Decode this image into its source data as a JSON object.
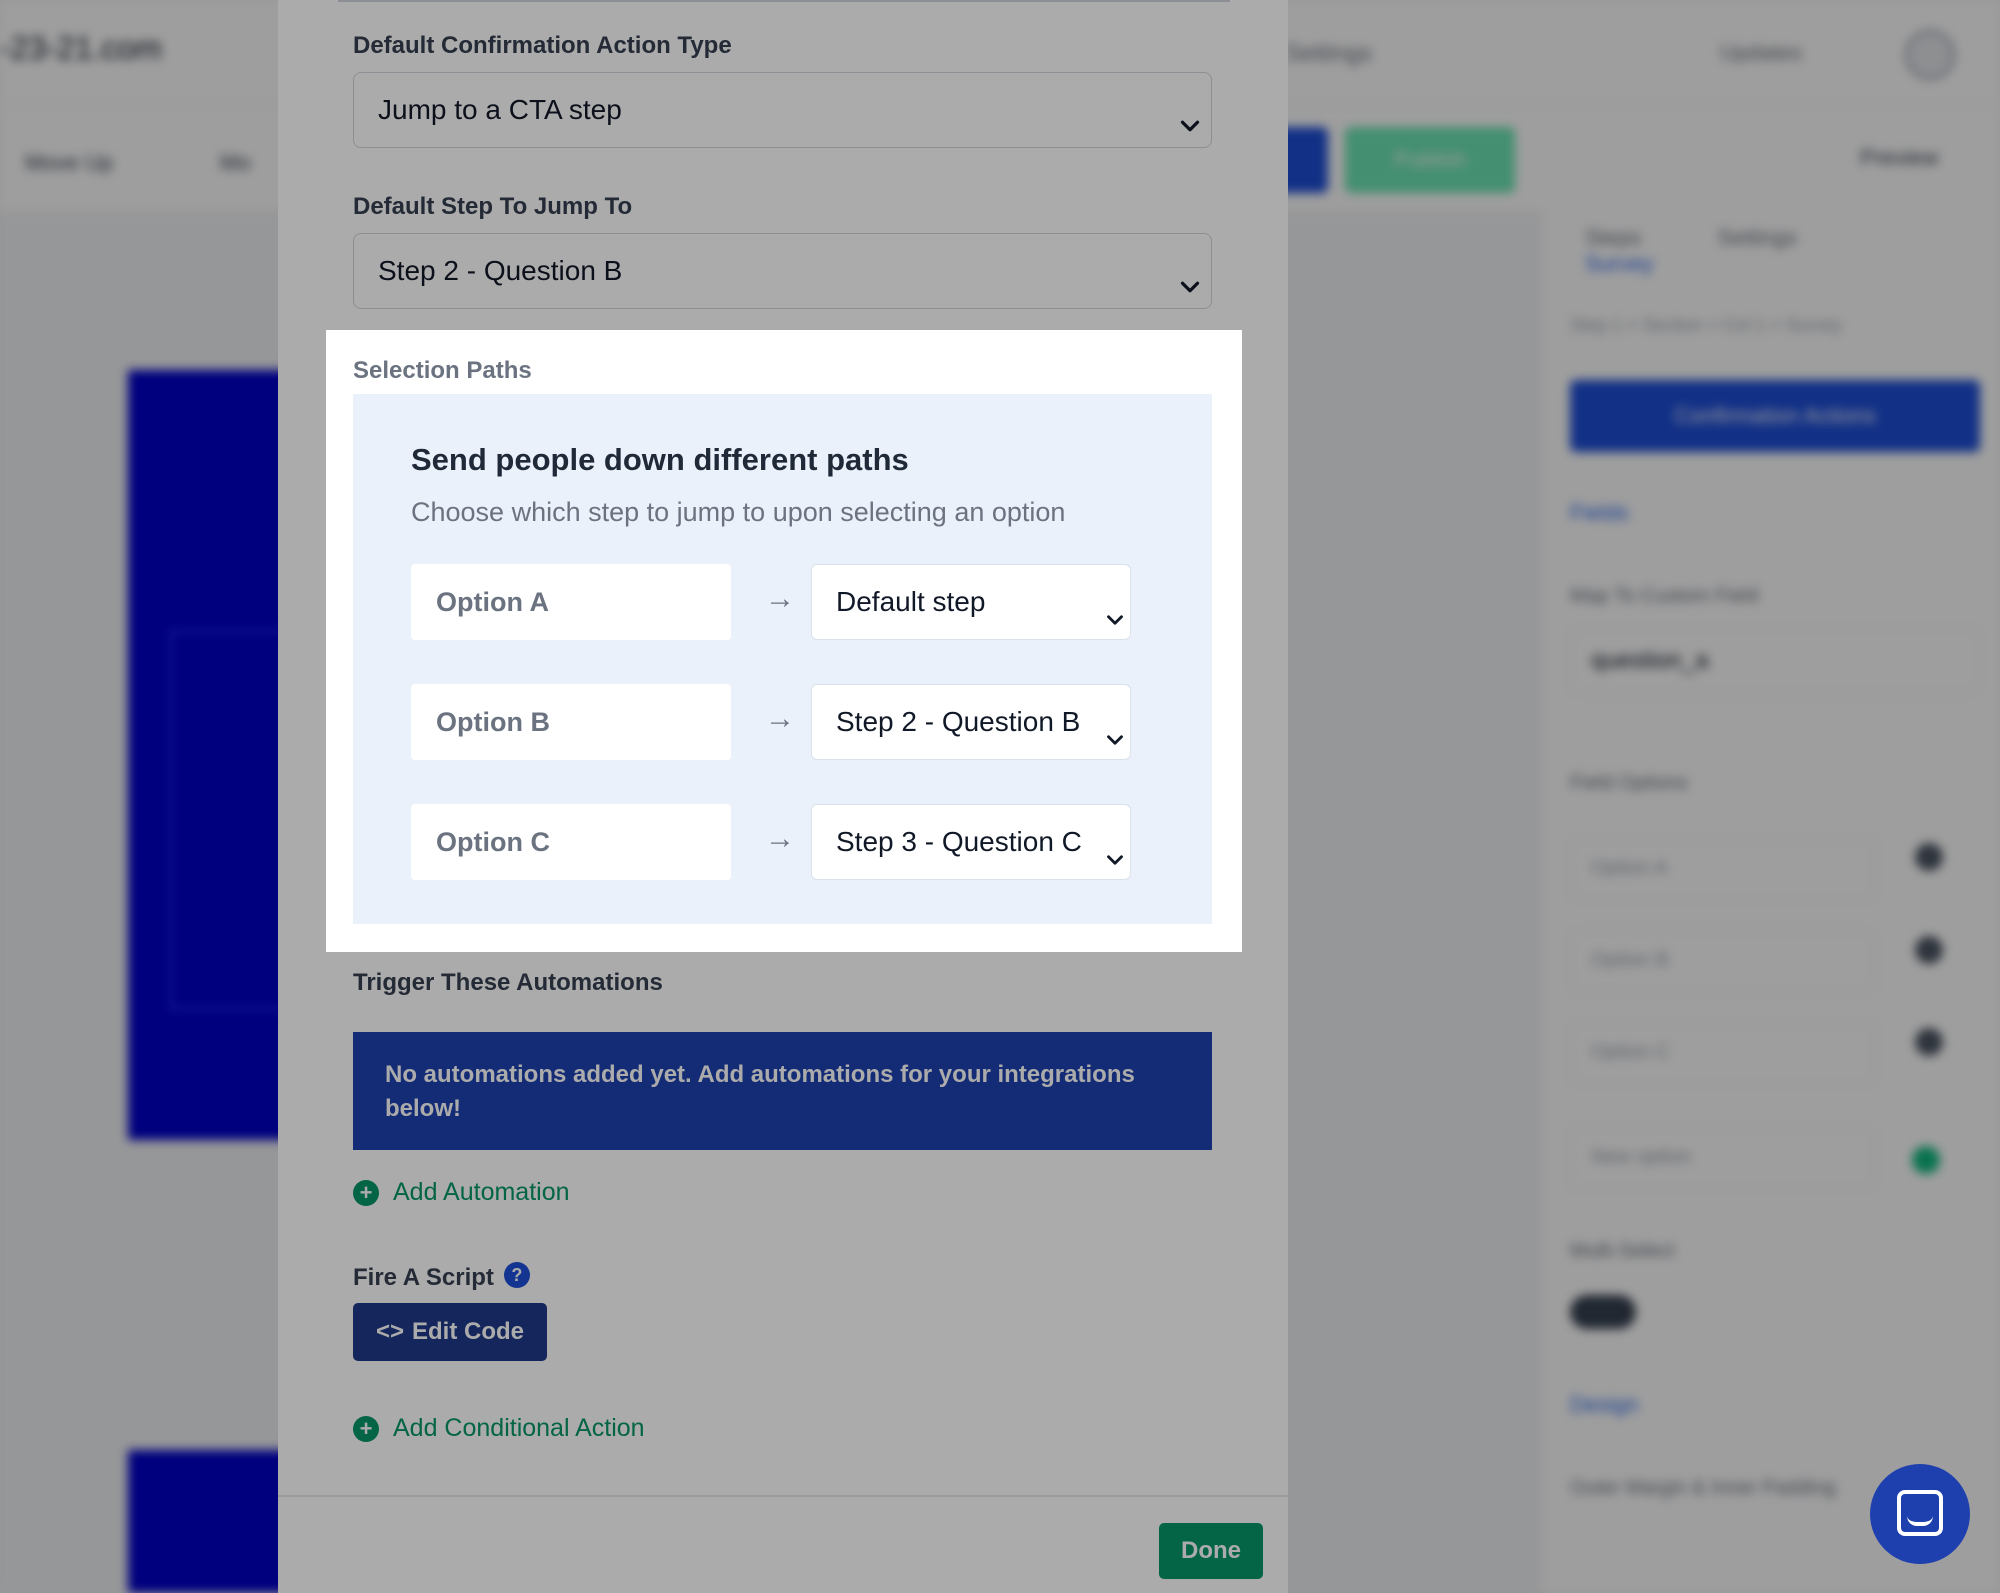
{
  "background": {
    "domain": "-23-21.com",
    "settings": "Settings",
    "updates": "Updates",
    "move_up": "Move Up",
    "move_down": "Mo",
    "publish": "Publish",
    "preview": "Preview",
    "tabs": [
      "Steps",
      "Settings",
      "Survey"
    ],
    "breadcrumb": "Step 1 > Section > Col 1 > Survey",
    "confirmation_actions": "Confirmation Actions",
    "fields": "Fields",
    "map_label": "Map To Custom Field",
    "map_value": "question_a",
    "field_options": "Field Options",
    "options": [
      "Option A",
      "Option B",
      "Option C"
    ],
    "new_option": "New option",
    "multi_select": "Multi-Select",
    "design": "Design",
    "outer_margin": "Outer Margin & Inner Padding"
  },
  "modal": {
    "confirmation_type_label": "Default Confirmation Action Type",
    "confirmation_type_value": "Jump to a CTA step",
    "default_step_label": "Default Step To Jump To",
    "default_step_value": "Step 2 - Question B",
    "selection_paths": {
      "label": "Selection Paths",
      "title": "Send people down different paths",
      "subtitle": "Choose which step to jump to upon selecting an option",
      "arrow": "→",
      "rows": [
        {
          "option": "Option A",
          "target": "Default step"
        },
        {
          "option": "Option B",
          "target": "Step 2 - Question B"
        },
        {
          "option": "Option C",
          "target": "Step 3 - Question C"
        }
      ]
    },
    "automations_label": "Trigger These Automations",
    "automations_empty": "No automations added yet. Add automations for your integrations below!",
    "add_automation": "Add Automation",
    "fire_script_label": "Fire A Script",
    "help_glyph": "?",
    "edit_code": "Edit Code",
    "add_conditional": "Add Conditional Action",
    "done": "Done"
  }
}
